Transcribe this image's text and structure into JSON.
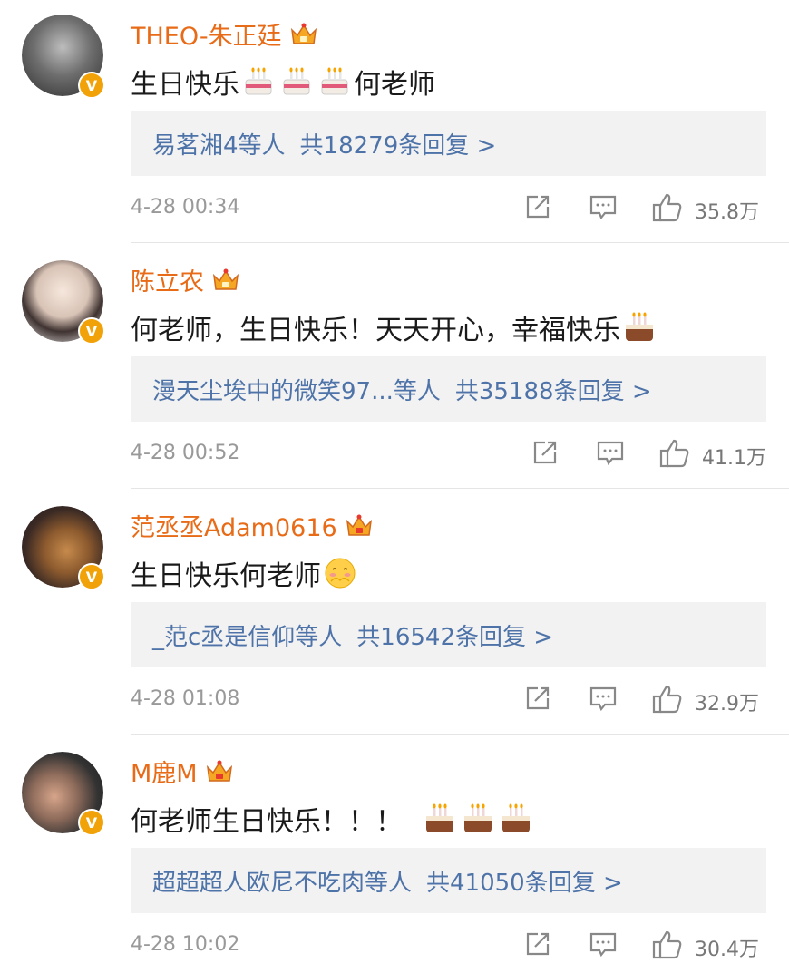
{
  "comments": [
    {
      "username": "THEO-朱正廷",
      "text_prefix": "生日快乐",
      "cakes_after_prefix": 3,
      "text_suffix": "何老师",
      "cakes_end": 0,
      "replies_who": "易茗湘4等人",
      "replies_count": "共18279条回复 >",
      "timestamp": "4-28 00:34",
      "likes": "35.8万"
    },
    {
      "username": "陈立农",
      "text_prefix": "何老师，生日快乐！天天开心，幸福快乐 ",
      "cakes_after_prefix": 1,
      "text_suffix": "",
      "cakes_end": 0,
      "replies_who": "漫天尘埃中的微笑97...等人",
      "replies_count": "共35188条回复 >",
      "timestamp": "4-28 00:52",
      "likes": "41.1万"
    },
    {
      "username": "范丞丞Adam0616",
      "text_prefix": "生日快乐何老师",
      "cakes_after_prefix": 0,
      "text_suffix": "",
      "cakes_end": 0,
      "replies_who": "_范c丞是信仰等人",
      "replies_count": "共16542条回复 >",
      "timestamp": "4-28 01:08",
      "likes": "32.9万"
    },
    {
      "username": "M鹿M",
      "text_prefix": "何老师生日快乐！！！",
      "cakes_after_prefix": 3,
      "text_suffix": "",
      "cakes_end": 0,
      "replies_who": "超超超人欧尼不吃肉等人",
      "replies_count": "共41050条回复 >",
      "timestamp": "4-28 10:02",
      "likes": "30.4万"
    }
  ],
  "icons": {
    "verified": "verified-v-badge-icon",
    "crown": "crown-icon",
    "share": "share-icon",
    "comment": "comment-icon",
    "like": "thumbs-up-icon",
    "cake": "birthday-cake-emoji",
    "blush": "blushing-face-emoji"
  },
  "badge_text": "V",
  "colors": {
    "username": "#e86b18",
    "reply_link": "#4e73a8",
    "reply_bg": "#f2f2f2",
    "meta": "#999999",
    "badge": "#f1a208"
  }
}
